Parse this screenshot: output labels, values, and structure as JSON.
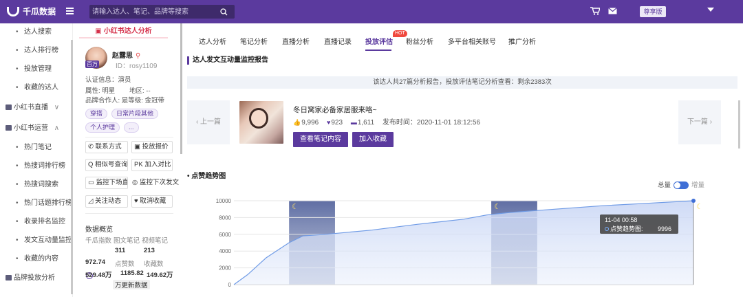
{
  "header": {
    "brand": "千瓜数据",
    "search_placeholder": "请输入达人、笔记、品牌等搜索",
    "vip_label": "尊享版"
  },
  "sidebar": {
    "items": [
      {
        "label": "达人搜索",
        "type": "sub"
      },
      {
        "label": "达人排行榜",
        "type": "sub"
      },
      {
        "label": "投放管理",
        "type": "sub"
      },
      {
        "label": "收藏的达人",
        "type": "sub"
      },
      {
        "label": "小红书直播",
        "type": "group",
        "arrow": "∨"
      },
      {
        "label": "小红书运营",
        "type": "group",
        "arrow": "∧"
      },
      {
        "label": "热门笔记",
        "type": "sub"
      },
      {
        "label": "热搜词排行榜",
        "type": "sub"
      },
      {
        "label": "热搜词搜索",
        "type": "sub"
      },
      {
        "label": "热门话题排行榜",
        "type": "sub"
      },
      {
        "label": "收录排名监控",
        "type": "sub"
      },
      {
        "label": "发文互动量监控",
        "type": "sub"
      },
      {
        "label": "收藏的内容",
        "type": "sub"
      },
      {
        "label": "品牌投放分析",
        "type": "group",
        "arrow": ""
      }
    ]
  },
  "profile": {
    "banner": "小红书达人分析",
    "avatar_badge": "百万",
    "name": "赵露思",
    "id": "ID：rosy1109",
    "cert": "认证信息：演员",
    "attr": "属性: 明星",
    "region": "地区: --",
    "brand_partner": "品牌合作人: 是等级: 金冠带",
    "tags": [
      "穿搭",
      "日常片段其他",
      "个人护理",
      "..."
    ],
    "buttons": [
      "联系方式",
      "投放报价",
      "相似号查询",
      "加入对比",
      "监控下场直播",
      "监控下次发文",
      "关注动态",
      "取消收藏"
    ],
    "stats_title": "数据概览",
    "stat_labels_1": [
      "千瓜指数",
      "图文笔记",
      "视频笔记"
    ],
    "stat_values_1": [
      "",
      "311",
      "213"
    ],
    "index_value": "972.74",
    "stat_labels_2": [
      "点赞数",
      "收藏数"
    ],
    "stat_values_2": [
      "529.48万",
      "1185.82",
      "149.62万"
    ],
    "refresh": "万更新数据"
  },
  "tabs": [
    "达人分析",
    "笔记分析",
    "直播分析",
    "直播记录",
    "投放评估",
    "粉丝分析",
    "多平台相关账号",
    "推广分析"
  ],
  "hot_label": "HOT",
  "report": {
    "title": "达人发文互动量监控报告",
    "notice": "该达人共27篇分析报告，投放评估笔记分析查看：剩余2383次",
    "prev": "上一篇",
    "next": "下一篇",
    "note_title": "冬日窝家必备家居服来咯~",
    "likes": "9,996",
    "collects": "923",
    "comments": "1,611",
    "publish_time": "发布时间：2020-11-01 18:12:56",
    "btn_view": "查看笔记内容",
    "btn_fav": "加入收藏"
  },
  "chart_section": {
    "title": "点赞趋势图",
    "toggle_left": "总量",
    "toggle_right": "增量"
  },
  "chart_data": {
    "type": "area",
    "title": "点赞趋势图",
    "xlabel": "",
    "ylabel": "",
    "ylim": [
      0,
      10000
    ],
    "yticks": [
      0,
      2000,
      4000,
      6000,
      8000,
      10000
    ],
    "series": [
      {
        "name": "点赞趋势图",
        "x": [
          0,
          0.03,
          0.07,
          0.12,
          0.15,
          0.2,
          0.3,
          0.4,
          0.5,
          0.55,
          0.6,
          0.7,
          0.8,
          0.9,
          1.0
        ],
        "values": [
          0,
          1200,
          3200,
          5000,
          5800,
          6000,
          6500,
          7200,
          7800,
          8300,
          8600,
          9000,
          9400,
          9700,
          9996
        ]
      }
    ],
    "night_bands": [
      [
        0.12,
        0.22
      ],
      [
        0.56,
        0.66
      ]
    ],
    "tooltip": {
      "time": "11-04 00:58",
      "series": "点赞趋势图:",
      "value": "9996"
    },
    "grid": true
  }
}
